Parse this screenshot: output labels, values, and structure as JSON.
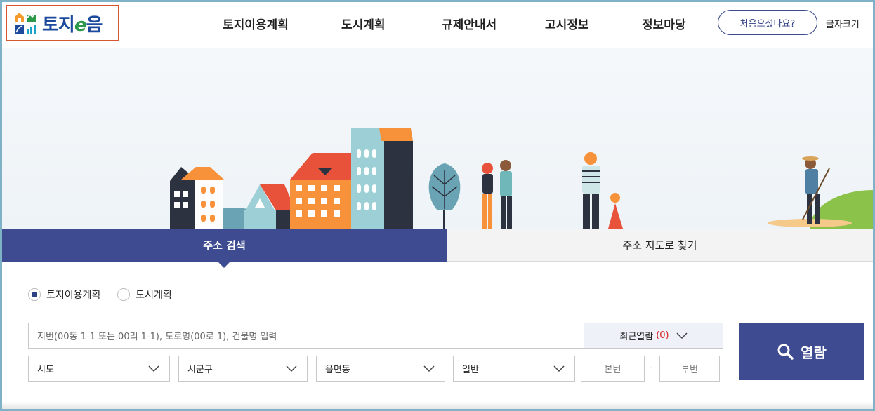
{
  "header": {
    "logo_text_a": "토지",
    "logo_text_e": "e",
    "logo_text_b": "음",
    "nav": [
      "토지이용계획",
      "도시계획",
      "규제안내서",
      "고시정보",
      "정보마당"
    ],
    "first_visit": "처음오셨나요?",
    "font_size": "글자크기"
  },
  "tabs": {
    "active": "주소 검색",
    "inactive": "주소 지도로 찾기"
  },
  "radios": [
    {
      "label": "토지이용계획",
      "selected": true
    },
    {
      "label": "도시계획",
      "selected": false
    }
  ],
  "search": {
    "placeholder": "지번(00동 1-1 또는 00리 1-1), 도로명(00로 1), 건물명 입력",
    "recent_label": "최근열람",
    "recent_count": "(0)"
  },
  "selects": [
    "시도",
    "시군구",
    "읍면동",
    "일반"
  ],
  "number_fields": {
    "main": "본번",
    "sub": "부번",
    "separator": "-"
  },
  "open_button": "열람",
  "icons": {
    "search": "search-icon",
    "chevron": "chevron-down-icon"
  },
  "colors": {
    "primary": "#3e4b90",
    "accent_red": "#d62020",
    "logo_frame": "#d5572b"
  }
}
